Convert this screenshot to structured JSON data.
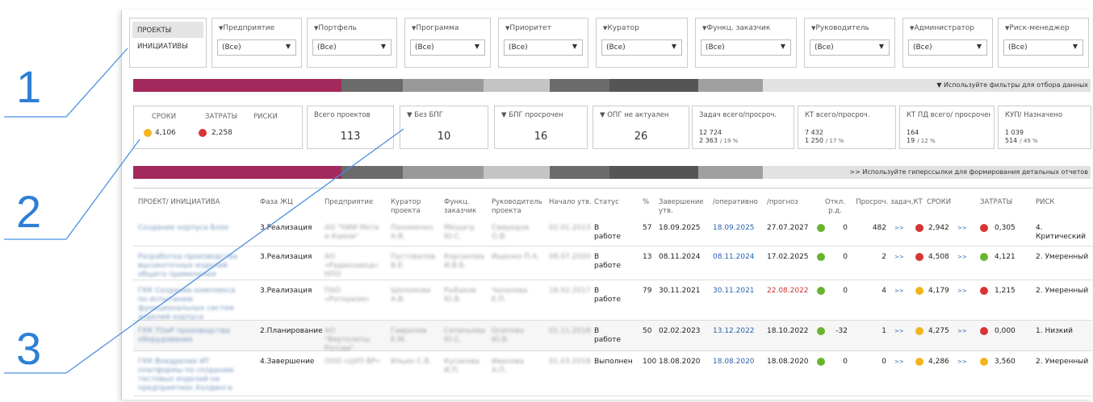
{
  "callouts": [
    "1",
    "2",
    "3"
  ],
  "tabs": [
    "ПРОЕКТЫ",
    "ИНИЦИАТИВЫ"
  ],
  "filters": [
    {
      "label": "Предприятие",
      "value": "(Все)"
    },
    {
      "label": "Портфель",
      "value": "(Все)"
    },
    {
      "label": "Программа",
      "value": "(Все)"
    },
    {
      "label": "Приоритет",
      "value": "(Все)"
    },
    {
      "label": "Куратор",
      "value": "(Все)"
    },
    {
      "label": "Функц. заказчик",
      "value": "(Все)"
    },
    {
      "label": "Руководитель",
      "value": "(Все)"
    },
    {
      "label": "Администратор",
      "value": "(Все)"
    },
    {
      "label": "Риск-менеджер",
      "value": "(Все)"
    }
  ],
  "bar1_text": "▼ Используйте фильтры для отбора данных",
  "bar2_text": ">> Используйте гиперссылки для формирования детальных отчетов",
  "bar_colors": [
    "#a3295c",
    "#6b6b6b",
    "#999999",
    "#c4c4c4",
    "#6b6b6b",
    "#555555",
    "#a0a0a0",
    "#e2e2e2"
  ],
  "tri": {
    "labels": [
      "СРОКИ",
      "ЗАТРАТЫ",
      "РИСКИ"
    ],
    "srok": "4,106",
    "zatr": "2,258"
  },
  "kpi": [
    {
      "label": "Всего проектов",
      "value": "113"
    },
    {
      "label": "▼ Без БПГ",
      "value": "10"
    },
    {
      "label": "▼ БПГ просрочен",
      "value": "16"
    },
    {
      "label": "▼ ОПГ не актуален",
      "value": "26"
    }
  ],
  "kpi2": [
    {
      "label": "Задач всего/просроч.",
      "v1": "12 724",
      "v2": "2 363",
      "v3": "/ 19 %"
    },
    {
      "label": "КТ всего/просроч.",
      "v1": "7 432",
      "v2": "1 250",
      "v3": "/ 17 %"
    },
    {
      "label": "КТ ПД всего/ просрочено",
      "v1": "164",
      "v2": "19",
      "v3": "/ 12 %"
    },
    {
      "label": "КУП/ Назначено",
      "v1": "1 039",
      "v2": "514",
      "v3": "/ 49 %"
    }
  ],
  "headers": [
    "ПРОЕКТ/ ИНИЦИАТИВА",
    "Фаза ЖЦ",
    "Предприятие",
    "Куратор проекта",
    "Функц. заказчик",
    "Руководитель проекта",
    "Начало утв.",
    "Статус",
    "%",
    "Завершение утв.",
    "/оперативно",
    "/прогноз",
    "Откл. р.д.",
    "Просроч. задач,КТ",
    "СРОКИ",
    "ЗАТРАТЫ",
    "РИСК"
  ],
  "rows": [
    {
      "proj": "Создание корпуса Блок",
      "phase": "3.Реализация",
      "ent": "АО \"НИИ Мета и Камов\"",
      "cur": "Пахоменко А.В.",
      "fz": "Мещагр Ю.С.",
      "ruk": "Свиридов О.В.",
      "start": "02.01.2013",
      "status": "В работе",
      "pct": "57",
      "end": "18.09.2025",
      "oper": "18.09.2025",
      "prog": "27.07.2027",
      "otkl": "0",
      "pros": "482",
      "srok": "2,942",
      "zatr": "0,305",
      "risk": "4. Критический",
      "c1": "#d93434",
      "c2": "#d93434",
      "progRed": false
    },
    {
      "proj": "Разработка производства высокоточных изделий общего применения",
      "phase": "3.Реализация",
      "ent": "АО «Радиозавод» НПО",
      "cur": "Пустовалов В.Е.",
      "fz": "Корсакова И.В.Б.",
      "ruk": "Ищенко П.А.",
      "start": "08.07.2020",
      "status": "В работе",
      "pct": "13",
      "end": "08.11.2024",
      "oper": "08.11.2024",
      "prog": "17.02.2025",
      "otkl": "0",
      "pros": "2",
      "srok": "4,508",
      "zatr": "4,121",
      "risk": "2. Умеренный",
      "c1": "#d93434",
      "c2": "#69b52e",
      "progRed": false
    },
    {
      "proj": "ГКК Создание комплекса по испытанию функциональных систем изделий корпуса",
      "phase": "3.Реализация",
      "ent": "ПАО «Роторизм»",
      "cur": "Шеломова А.В.",
      "fz": "Рыбаков Ю.В.",
      "ruk": "Чазанова Е.П.",
      "start": "16.02.2017",
      "status": "В работе",
      "pct": "79",
      "end": "30.11.2021",
      "oper": "30.11.2021",
      "prog": "22.08.2022",
      "otkl": "0",
      "pros": "4",
      "srok": "4,179",
      "zatr": "1,215",
      "risk": "2. Умеренный",
      "c1": "#f2b51c",
      "c2": "#d93434",
      "progRed": true
    },
    {
      "proj": "ГКК ТОиР производства оборудования",
      "phase": "2.Планирование",
      "ent": "АО \"Вертолеты России\"",
      "cur": "Гаврилов Е.М.",
      "fz": "Сепеньева Ю.С.",
      "ruk": "Осипова Ю.В.",
      "start": "01.11.2018",
      "status": "В работе",
      "pct": "50",
      "end": "02.02.2023",
      "oper": "13.12.2022",
      "prog": "18.10.2022",
      "otkl": "-32",
      "pros": "1",
      "srok": "4,275",
      "zatr": "0,000",
      "risk": "1. Низкий",
      "c1": "#f2b51c",
      "c2": "#d93434",
      "progRed": false
    },
    {
      "proj": "ГКК Внедрение ИТ платформы по созданию тестовых изделий на предприятиях Холдинга",
      "phase": "4.Завершение",
      "ent": "ООО «ЦУП ВР»",
      "cur": "Ильин С.В.",
      "fz": "Кусакова И.П.",
      "ruk": "Иванова А.П.",
      "start": "01.03.2018",
      "status": "Выполнен",
      "pct": "100",
      "end": "18.08.2020",
      "oper": "18.08.2020",
      "prog": "18.08.2020",
      "otkl": "0",
      "pros": "0",
      "srok": "4,286",
      "zatr": "3,560",
      "risk": "2. Умеренный",
      "c1": "#f2b51c",
      "c2": "#f2b51c",
      "progRed": false
    }
  ]
}
